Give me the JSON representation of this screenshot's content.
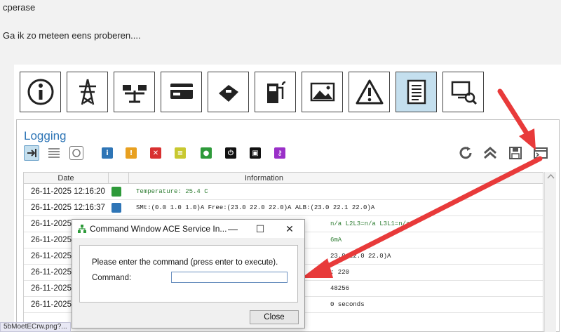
{
  "post": {
    "author": "cperase",
    "message": "Ga ik zo meteen eens proberen...."
  },
  "toolbar": {
    "buttons": [
      {
        "icon": "info-icon"
      },
      {
        "icon": "power-tower-icon"
      },
      {
        "icon": "load-balance-icon"
      },
      {
        "icon": "card-icon"
      },
      {
        "icon": "card-terminal-icon"
      },
      {
        "icon": "charger-icon"
      },
      {
        "icon": "image-icon"
      },
      {
        "icon": "warning-icon"
      },
      {
        "icon": "log-document-icon",
        "active": true
      },
      {
        "icon": "remote-service-icon"
      }
    ]
  },
  "logging": {
    "title": "Logging",
    "columns": {
      "date": "Date",
      "info": "Information"
    },
    "rows": [
      {
        "date": "26-11-2025 12:16:20",
        "type": "green",
        "info": "Temperature: 25.4 C"
      },
      {
        "date": "26-11-2025 12:16:37",
        "type": "blue",
        "info": "SMt:(0.0 1.0 1.0)A Free:(23.0 22.0 22.0)A ALB:(23.0 22.1 22.0)A"
      },
      {
        "date": "26-11-2025",
        "type": "none",
        "info": "n/a L2L3=n/a L3L1=n/a"
      },
      {
        "date": "26-11-2025",
        "type": "none",
        "info": "6mA"
      },
      {
        "date": "26-11-2025",
        "type": "none",
        "info": "23.0 22.0 22.0)A"
      },
      {
        "date": "26-11-2025",
        "type": "none",
        "info": ": 220"
      },
      {
        "date": "26-11-2025",
        "type": "none",
        "info": "48256"
      },
      {
        "date": "26-11-2025",
        "type": "none",
        "info": "0 seconds"
      }
    ]
  },
  "dialog": {
    "title": "Command Window ACE Service In...",
    "prompt": "Please enter the command (press enter to execute).",
    "command_label": "Command:",
    "command_value": "",
    "close_label": "Close"
  },
  "tooltip": "5bMoetECrw.png?...",
  "colors": {
    "accent_blue": "#2e75b6",
    "active_button": "#c4dfee",
    "log_green": "#2e7d32",
    "arrow_red": "#e83a3a"
  }
}
